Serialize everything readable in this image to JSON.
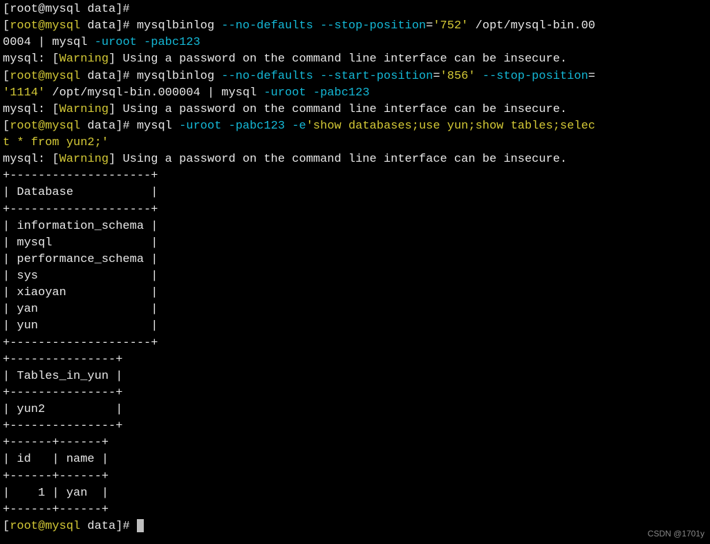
{
  "prompt_prefix_open": "[",
  "prompt_user_host": "root@mysql",
  "prompt_dir": " data",
  "prompt_prefix_close": "]#",
  "line0_truncated": "[root@mysql data]#",
  "cmd1": {
    "bin": " mysqlbinlog",
    "flag_nodef": " --no-defaults",
    "flag_stop": " --stop-position",
    "eq": "=",
    "stop_val": "'752'",
    "file": " /opt/mysql-bin.00",
    "file_wrap": "0004 ",
    "pipe": "|",
    "mysql": " mysql",
    "uroot": " -uroot",
    "pabc": " -pabc123"
  },
  "warning_label": "Warning",
  "warning_open": "mysql: [",
  "warning_close": "]",
  "warning_text": " Using a password on the command line interface can be insecure.",
  "cmd2": {
    "bin": " mysqlbinlog",
    "flag_nodef": " --no-defaults",
    "flag_start": " --start-position",
    "eq": "=",
    "start_val": "'856'",
    "flag_stop": " --stop-position",
    "stop_eq": "=",
    "stop_val_wrap": "'1114'",
    "file": " /opt/mysql-bin.000004 ",
    "pipe": "|",
    "mysql": " mysql",
    "uroot": " -uroot",
    "pabc": " -pabc123"
  },
  "cmd3": {
    "bin": " mysql",
    "uroot": " -uroot",
    "pabc": " -pabc123",
    "dash_e": " -e",
    "sql_part1": "'show databases;use yun;show tables;selec",
    "sql_part2": "t * from yun2;'"
  },
  "table_db": {
    "border_top": "+--------------------+",
    "header": "| Database           |",
    "border_mid": "+--------------------+",
    "rows": [
      "| information_schema |",
      "| mysql              |",
      "| performance_schema |",
      "| sys                |",
      "| xiaoyan            |",
      "| yan                |",
      "| yun                |"
    ],
    "border_bot": "+--------------------+"
  },
  "table_tables": {
    "border_top": "+---------------+",
    "header": "| Tables_in_yun |",
    "border_mid": "+---------------+",
    "rows": [
      "| yun2          |"
    ],
    "border_bot": "+---------------+"
  },
  "table_yun2": {
    "border_top": "+------+------+",
    "header": "| id   | name |",
    "border_mid": "+------+------+",
    "rows": [
      "|    1 | yan  |"
    ],
    "border_bot": "+------+------+"
  },
  "final_prompt_space": " ",
  "watermark": "CSDN @1701y"
}
